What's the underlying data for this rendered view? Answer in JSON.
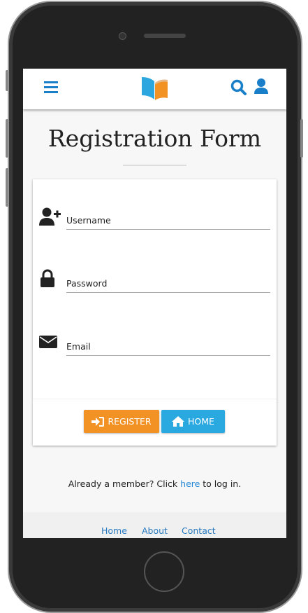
{
  "header": {
    "menu_icon": "hamburger-icon",
    "logo_icon": "open-book-logo",
    "search_icon": "search-icon",
    "user_icon": "user-icon"
  },
  "page_title": "Registration Form",
  "form": {
    "fields": [
      {
        "label": "Username",
        "icon": "user-plus-icon",
        "value": ""
      },
      {
        "label": "Password",
        "icon": "lock-icon",
        "value": ""
      },
      {
        "label": "Email",
        "icon": "envelope-icon",
        "value": ""
      }
    ],
    "register_label": "REGISTER",
    "home_label": "HOME"
  },
  "member": {
    "prefix": "Already a member? Click ",
    "link": "here",
    "suffix": " to log in."
  },
  "footer": {
    "links": [
      "Home",
      "About",
      "Contact"
    ]
  },
  "colors": {
    "primary": "#1a7fc9",
    "register": "#f39224",
    "home": "#2aa9e0"
  }
}
